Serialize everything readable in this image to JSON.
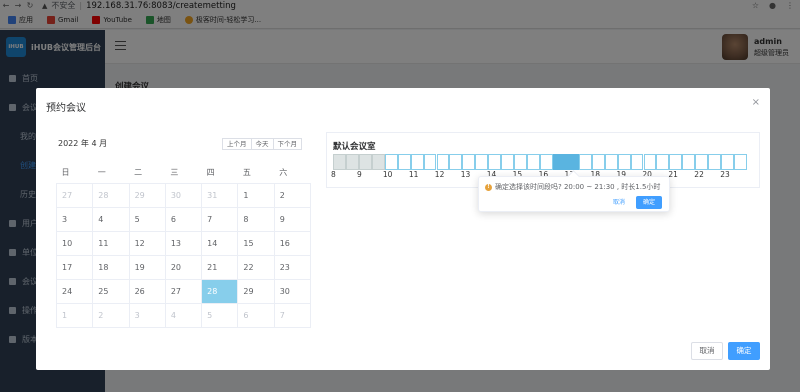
{
  "browser": {
    "insecure_label": "不安全",
    "url": "192.168.31.76:8083/createmetting",
    "bookmarks": [
      {
        "label": "应用",
        "icon": "apps-icon"
      },
      {
        "label": "Gmail",
        "icon": "gmail-icon"
      },
      {
        "label": "YouTube",
        "icon": "youtube-icon"
      },
      {
        "label": "地图",
        "icon": "maps-icon"
      },
      {
        "label": "极客时间-轻松学习...",
        "icon": "geektime-icon"
      }
    ]
  },
  "app": {
    "logo_text": "iHUB",
    "title": "iHUB会议管理后台",
    "page_title": "创建会议"
  },
  "sidebar": {
    "items": [
      {
        "label": "首页"
      },
      {
        "label": "会议"
      },
      {
        "label": "我的"
      },
      {
        "label": "创建"
      },
      {
        "label": "历史"
      },
      {
        "label": "用户"
      },
      {
        "label": "单位"
      },
      {
        "label": "会议"
      },
      {
        "label": "操作"
      },
      {
        "label": "版本"
      }
    ]
  },
  "user": {
    "name": "admin",
    "role": "超级管理员"
  },
  "dialog": {
    "title": "预约会议",
    "close_icon": "×",
    "cancel_label": "取消",
    "confirm_label": "确定"
  },
  "calendar": {
    "month_label": "2022 年 4 月",
    "prev_label": "上个月",
    "today_label": "今天",
    "next_label": "下个月",
    "weekdays": [
      "日",
      "一",
      "二",
      "三",
      "四",
      "五",
      "六"
    ],
    "weeks": [
      [
        {
          "d": "27",
          "o": true
        },
        {
          "d": "28",
          "o": true
        },
        {
          "d": "29",
          "o": true
        },
        {
          "d": "30",
          "o": true
        },
        {
          "d": "31",
          "o": true
        },
        {
          "d": "1"
        },
        {
          "d": "2"
        }
      ],
      [
        {
          "d": "3"
        },
        {
          "d": "4"
        },
        {
          "d": "5"
        },
        {
          "d": "6"
        },
        {
          "d": "7"
        },
        {
          "d": "8"
        },
        {
          "d": "9"
        }
      ],
      [
        {
          "d": "10"
        },
        {
          "d": "11"
        },
        {
          "d": "12"
        },
        {
          "d": "13"
        },
        {
          "d": "14"
        },
        {
          "d": "15"
        },
        {
          "d": "16"
        }
      ],
      [
        {
          "d": "17"
        },
        {
          "d": "18"
        },
        {
          "d": "19"
        },
        {
          "d": "20"
        },
        {
          "d": "21"
        },
        {
          "d": "22"
        },
        {
          "d": "23"
        }
      ],
      [
        {
          "d": "24"
        },
        {
          "d": "25"
        },
        {
          "d": "26"
        },
        {
          "d": "27"
        },
        {
          "d": "28",
          "s": true
        },
        {
          "d": "29"
        },
        {
          "d": "30"
        }
      ],
      [
        {
          "d": "1",
          "o": true
        },
        {
          "d": "2",
          "o": true
        },
        {
          "d": "3",
          "o": true
        },
        {
          "d": "4",
          "o": true
        },
        {
          "d": "5",
          "o": true
        },
        {
          "d": "6",
          "o": true
        },
        {
          "d": "7",
          "o": true
        }
      ]
    ]
  },
  "room": {
    "title": "默认会议室",
    "hours": [
      "8",
      "9",
      "10",
      "11",
      "12",
      "13",
      "14",
      "15",
      "16",
      "17",
      "18",
      "19",
      "20",
      "21",
      "22",
      "23"
    ],
    "past_slots": 4,
    "selected_slots": [
      17,
      18
    ],
    "slot_count": 32
  },
  "popconfirm": {
    "message": "确定选择该时间段吗? 20:00 ~ 21:30 , 时长1.5小时",
    "cancel_label": "取消",
    "confirm_label": "确定"
  }
}
